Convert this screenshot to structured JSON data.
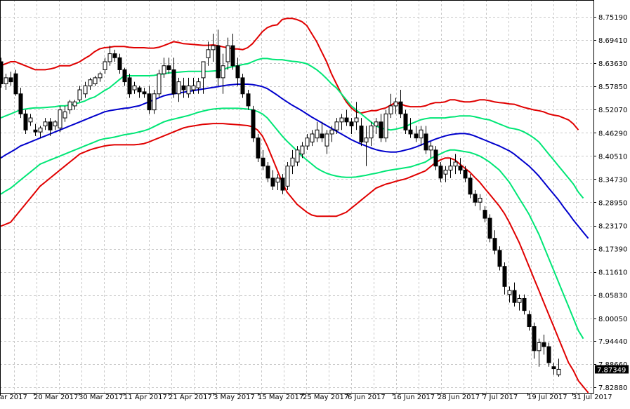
{
  "chart_data": {
    "type": "candlestick",
    "ylim": [
      7.8288,
      8.7519
    ],
    "y_ticks": [
      "8.75190",
      "8.69410",
      "8.63630",
      "8.57850",
      "8.52070",
      "8.46290",
      "8.40510",
      "8.34730",
      "8.28950",
      "8.23170",
      "8.17390",
      "8.11610",
      "8.05830",
      "8.00050",
      "7.94440",
      "7.88660",
      "7.82880"
    ],
    "x_tick_labels": [
      "ar 2017",
      "20 Mar 2017",
      "30 Mar 2017",
      "11 Apr 2017",
      "21 Apr 2017",
      "3 May 2017",
      "15 May 2017",
      "25 May 2017",
      "6 Jun 2017",
      "16 Jun 2017",
      "28 Jun 2017",
      "7 Jul 2017",
      "19 Jul 2017",
      "31 Jul 2017"
    ],
    "current_price": "7.87349",
    "grid": true,
    "colors": {
      "outer_band": "#e00000",
      "inner_band": "#00e676",
      "middle_ma": "#0000cc",
      "bull_candle": "#ffffff",
      "bear_candle": "#000000",
      "price_tag_bg": "#000000",
      "price_tag_text": "#ffffff"
    },
    "candles": [
      [
        8.64,
        8.65,
        8.575,
        8.585
      ],
      [
        8.585,
        8.61,
        8.57,
        8.6
      ],
      [
        8.6,
        8.615,
        8.58,
        8.59
      ],
      [
        8.61,
        8.62,
        8.555,
        8.56
      ],
      [
        8.56,
        8.575,
        8.5,
        8.51
      ],
      [
        8.51,
        8.52,
        8.46,
        8.47
      ],
      [
        8.49,
        8.51,
        8.48,
        8.5
      ],
      [
        8.47,
        8.485,
        8.455,
        8.465
      ],
      [
        8.465,
        8.48,
        8.45,
        8.475
      ],
      [
        8.48,
        8.5,
        8.47,
        8.49
      ],
      [
        8.49,
        8.5,
        8.455,
        8.47
      ],
      [
        8.48,
        8.495,
        8.47,
        8.49
      ],
      [
        8.475,
        8.53,
        8.465,
        8.52
      ],
      [
        8.5,
        8.53,
        8.49,
        8.515
      ],
      [
        8.52,
        8.545,
        8.51,
        8.54
      ],
      [
        8.53,
        8.545,
        8.52,
        8.54
      ],
      [
        8.545,
        8.58,
        8.54,
        8.57
      ],
      [
        8.56,
        8.59,
        8.55,
        8.58
      ],
      [
        8.58,
        8.6,
        8.57,
        8.595
      ],
      [
        8.585,
        8.605,
        8.58,
        8.6
      ],
      [
        8.6,
        8.615,
        8.59,
        8.61
      ],
      [
        8.62,
        8.65,
        8.61,
        8.64
      ],
      [
        8.64,
        8.68,
        8.63,
        8.66
      ],
      [
        8.66,
        8.67,
        8.64,
        8.65
      ],
      [
        8.65,
        8.66,
        8.61,
        8.62
      ],
      [
        8.62,
        8.625,
        8.58,
        8.59
      ],
      [
        8.6,
        8.61,
        8.55,
        8.56
      ],
      [
        8.57,
        8.59,
        8.56,
        8.58
      ],
      [
        8.575,
        8.58,
        8.55,
        8.565
      ],
      [
        8.565,
        8.575,
        8.55,
        8.56
      ],
      [
        8.56,
        8.58,
        8.51,
        8.52
      ],
      [
        8.52,
        8.57,
        8.51,
        8.56
      ],
      [
        8.56,
        8.62,
        8.55,
        8.61
      ],
      [
        8.61,
        8.65,
        8.6,
        8.63
      ],
      [
        8.63,
        8.65,
        8.61,
        8.62
      ],
      [
        8.62,
        8.65,
        8.55,
        8.56
      ],
      [
        8.56,
        8.6,
        8.54,
        8.59
      ],
      [
        8.58,
        8.6,
        8.55,
        8.57
      ],
      [
        8.56,
        8.6,
        8.55,
        8.58
      ],
      [
        8.57,
        8.6,
        8.56,
        8.58
      ],
      [
        8.575,
        8.6,
        8.56,
        8.59
      ],
      [
        8.6,
        8.64,
        8.56,
        8.64
      ],
      [
        8.65,
        8.69,
        8.63,
        8.67
      ],
      [
        8.67,
        8.71,
        8.64,
        8.68
      ],
      [
        8.68,
        8.72,
        8.58,
        8.6
      ],
      [
        8.6,
        8.66,
        8.56,
        8.63
      ],
      [
        8.64,
        8.7,
        8.62,
        8.68
      ],
      [
        8.68,
        8.71,
        8.62,
        8.63
      ],
      [
        8.63,
        8.65,
        8.58,
        8.6
      ],
      [
        8.6,
        8.61,
        8.55,
        8.56
      ],
      [
        8.56,
        8.57,
        8.52,
        8.53
      ],
      [
        8.52,
        8.53,
        8.44,
        8.45
      ],
      [
        8.45,
        8.46,
        8.39,
        8.4
      ],
      [
        8.4,
        8.42,
        8.37,
        8.38
      ],
      [
        8.38,
        8.39,
        8.34,
        8.35
      ],
      [
        8.35,
        8.37,
        8.32,
        8.33
      ],
      [
        8.34,
        8.36,
        8.32,
        8.35
      ],
      [
        8.35,
        8.36,
        8.31,
        8.32
      ],
      [
        8.33,
        8.39,
        8.32,
        8.38
      ],
      [
        8.38,
        8.42,
        8.36,
        8.4
      ],
      [
        8.39,
        8.43,
        8.38,
        8.42
      ],
      [
        8.41,
        8.44,
        8.4,
        8.43
      ],
      [
        8.43,
        8.46,
        8.42,
        8.45
      ],
      [
        8.44,
        8.47,
        8.43,
        8.46
      ],
      [
        8.45,
        8.49,
        8.44,
        8.47
      ],
      [
        8.46,
        8.49,
        8.44,
        8.45
      ],
      [
        8.43,
        8.47,
        8.41,
        8.46
      ],
      [
        8.46,
        8.48,
        8.44,
        8.47
      ],
      [
        8.47,
        8.5,
        8.46,
        8.49
      ],
      [
        8.49,
        8.51,
        8.47,
        8.5
      ],
      [
        8.5,
        8.52,
        8.48,
        8.49
      ],
      [
        8.49,
        8.5,
        8.46,
        8.48
      ],
      [
        8.49,
        8.54,
        8.47,
        8.5
      ],
      [
        8.48,
        8.5,
        8.43,
        8.44
      ],
      [
        8.44,
        8.48,
        8.38,
        8.45
      ],
      [
        8.45,
        8.49,
        8.43,
        8.48
      ],
      [
        8.48,
        8.5,
        8.46,
        8.49
      ],
      [
        8.49,
        8.51,
        8.44,
        8.45
      ],
      [
        8.45,
        8.52,
        8.44,
        8.51
      ],
      [
        8.51,
        8.56,
        8.5,
        8.53
      ],
      [
        8.53,
        8.55,
        8.51,
        8.54
      ],
      [
        8.54,
        8.57,
        8.5,
        8.51
      ],
      [
        8.51,
        8.52,
        8.46,
        8.47
      ],
      [
        8.47,
        8.5,
        8.45,
        8.46
      ],
      [
        8.46,
        8.48,
        8.44,
        8.45
      ],
      [
        8.45,
        8.48,
        8.43,
        8.47
      ],
      [
        8.46,
        8.48,
        8.41,
        8.42
      ],
      [
        8.42,
        8.44,
        8.4,
        8.43
      ],
      [
        8.42,
        8.43,
        8.37,
        8.38
      ],
      [
        8.38,
        8.39,
        8.34,
        8.35
      ],
      [
        8.36,
        8.38,
        8.34,
        8.37
      ],
      [
        8.37,
        8.4,
        8.35,
        8.38
      ],
      [
        8.38,
        8.41,
        8.36,
        8.39
      ],
      [
        8.38,
        8.4,
        8.36,
        8.37
      ],
      [
        8.37,
        8.38,
        8.34,
        8.35
      ],
      [
        8.35,
        8.36,
        8.3,
        8.31
      ],
      [
        8.31,
        8.32,
        8.28,
        8.29
      ],
      [
        8.29,
        8.31,
        8.27,
        8.3
      ],
      [
        8.27,
        8.28,
        8.24,
        8.25
      ],
      [
        8.25,
        8.26,
        8.19,
        8.2
      ],
      [
        8.2,
        8.22,
        8.16,
        8.17
      ],
      [
        8.17,
        8.18,
        8.12,
        8.13
      ],
      [
        8.13,
        8.14,
        8.06,
        8.08
      ],
      [
        8.06,
        8.08,
        8.04,
        8.07
      ],
      [
        8.07,
        8.09,
        8.03,
        8.04
      ],
      [
        8.04,
        8.06,
        8.02,
        8.05
      ],
      [
        8.05,
        8.06,
        8.01,
        8.02
      ],
      [
        8.01,
        8.02,
        7.97,
        7.98
      ],
      [
        7.98,
        7.99,
        7.9,
        7.92
      ],
      [
        7.92,
        7.95,
        7.88,
        7.94
      ],
      [
        7.94,
        7.96,
        7.91,
        7.93
      ],
      [
        7.93,
        7.94,
        7.88,
        7.89
      ],
      [
        7.88,
        7.89,
        7.86,
        7.875
      ],
      [
        7.86,
        7.9,
        7.855,
        7.87349
      ]
    ],
    "upper_outer_band": [
      8.63,
      8.635,
      8.64,
      8.64,
      8.635,
      8.63,
      8.625,
      8.62,
      8.62,
      8.62,
      8.622,
      8.625,
      8.63,
      8.63,
      8.63,
      8.635,
      8.64,
      8.648,
      8.655,
      8.665,
      8.672,
      8.675,
      8.676,
      8.678,
      8.678,
      8.678,
      8.676,
      8.675,
      8.675,
      8.675,
      8.674,
      8.674,
      8.676,
      8.68,
      8.685,
      8.69,
      8.688,
      8.685,
      8.684,
      8.683,
      8.682,
      8.681,
      8.681,
      8.682,
      8.68,
      8.677,
      8.675,
      8.672,
      8.672,
      8.67,
      8.675,
      8.685,
      8.7,
      8.715,
      8.725,
      8.73,
      8.732,
      8.745,
      8.748,
      8.748,
      8.745,
      8.74,
      8.73,
      8.71,
      8.69,
      8.665,
      8.64,
      8.61,
      8.585,
      8.56,
      8.54,
      8.525,
      8.515,
      8.512,
      8.515,
      8.518,
      8.518,
      8.522,
      8.525,
      8.532,
      8.538,
      8.535,
      8.53,
      8.528,
      8.528,
      8.528,
      8.53,
      8.535,
      8.538,
      8.538,
      8.54,
      8.545,
      8.545,
      8.542,
      8.54,
      8.54,
      8.542,
      8.545,
      8.545,
      8.543,
      8.54,
      8.538,
      8.537,
      8.535,
      8.534,
      8.53,
      8.526,
      8.523,
      8.52,
      8.518,
      8.515,
      8.51,
      8.507,
      8.505,
      8.5,
      8.495,
      8.485,
      8.47
    ],
    "upper_inner_band": [
      8.5,
      8.505,
      8.51,
      8.515,
      8.52,
      8.522,
      8.524,
      8.525,
      8.525,
      8.526,
      8.527,
      8.528,
      8.53,
      8.53,
      8.532,
      8.535,
      8.538,
      8.542,
      8.548,
      8.552,
      8.56,
      8.568,
      8.575,
      8.585,
      8.595,
      8.605,
      8.605,
      8.605,
      8.605,
      8.605,
      8.605,
      8.606,
      8.608,
      8.61,
      8.612,
      8.613,
      8.614,
      8.615,
      8.616,
      8.616,
      8.616,
      8.616,
      8.616,
      8.617,
      8.618,
      8.62,
      8.625,
      8.628,
      8.63,
      8.633,
      8.635,
      8.64,
      8.645,
      8.648,
      8.648,
      8.646,
      8.645,
      8.645,
      8.643,
      8.641,
      8.64,
      8.638,
      8.635,
      8.628,
      8.62,
      8.61,
      8.598,
      8.585,
      8.575,
      8.56,
      8.545,
      8.53,
      8.52,
      8.51,
      8.5,
      8.49,
      8.48,
      8.475,
      8.472,
      8.47,
      8.472,
      8.475,
      8.478,
      8.485,
      8.49,
      8.495,
      8.498,
      8.5,
      8.5,
      8.5,
      8.5,
      8.502,
      8.503,
      8.505,
      8.505,
      8.505,
      8.503,
      8.5,
      8.497,
      8.495,
      8.49,
      8.485,
      8.48,
      8.475,
      8.473,
      8.47,
      8.465,
      8.458,
      8.45,
      8.44,
      8.425,
      8.41,
      8.395,
      8.38,
      8.365,
      8.35,
      8.335,
      8.315,
      8.3
    ],
    "middle_ma": [
      8.4,
      8.408,
      8.415,
      8.422,
      8.43,
      8.435,
      8.44,
      8.445,
      8.45,
      8.455,
      8.46,
      8.465,
      8.47,
      8.475,
      8.48,
      8.485,
      8.49,
      8.495,
      8.5,
      8.505,
      8.51,
      8.515,
      8.518,
      8.52,
      8.522,
      8.524,
      8.525,
      8.528,
      8.53,
      8.535,
      8.54,
      8.545,
      8.55,
      8.555,
      8.558,
      8.56,
      8.562,
      8.564,
      8.566,
      8.568,
      8.57,
      8.572,
      8.574,
      8.576,
      8.578,
      8.58,
      8.582,
      8.583,
      8.584,
      8.584,
      8.584,
      8.583,
      8.581,
      8.578,
      8.573,
      8.565,
      8.557,
      8.548,
      8.54,
      8.532,
      8.525,
      8.518,
      8.51,
      8.502,
      8.495,
      8.488,
      8.481,
      8.474,
      8.467,
      8.46,
      8.453,
      8.446,
      8.44,
      8.435,
      8.43,
      8.425,
      8.421,
      8.418,
      8.416,
      8.415,
      8.415,
      8.417,
      8.42,
      8.423,
      8.427,
      8.432,
      8.437,
      8.442,
      8.447,
      8.451,
      8.455,
      8.458,
      8.46,
      8.461,
      8.461,
      8.459,
      8.455,
      8.45,
      8.445,
      8.44,
      8.435,
      8.43,
      8.424,
      8.418,
      8.41,
      8.4,
      8.39,
      8.38,
      8.368,
      8.355,
      8.34,
      8.325,
      8.31,
      8.295,
      8.278,
      8.262,
      8.245,
      8.23,
      8.215,
      8.2
    ],
    "lower_inner_band": [
      8.31,
      8.318,
      8.325,
      8.335,
      8.345,
      8.355,
      8.365,
      8.375,
      8.385,
      8.39,
      8.395,
      8.4,
      8.405,
      8.41,
      8.415,
      8.42,
      8.425,
      8.43,
      8.435,
      8.44,
      8.445,
      8.448,
      8.45,
      8.452,
      8.455,
      8.458,
      8.46,
      8.462,
      8.465,
      8.468,
      8.472,
      8.478,
      8.484,
      8.49,
      8.494,
      8.497,
      8.5,
      8.503,
      8.506,
      8.51,
      8.514,
      8.517,
      8.52,
      8.522,
      8.523,
      8.524,
      8.524,
      8.524,
      8.524,
      8.523,
      8.522,
      8.52,
      8.516,
      8.51,
      8.5,
      8.485,
      8.47,
      8.455,
      8.442,
      8.43,
      8.418,
      8.405,
      8.395,
      8.385,
      8.375,
      8.368,
      8.362,
      8.358,
      8.355,
      8.353,
      8.352,
      8.352,
      8.353,
      8.355,
      8.357,
      8.36,
      8.362,
      8.365,
      8.368,
      8.37,
      8.372,
      8.374,
      8.376,
      8.378,
      8.382,
      8.386,
      8.39,
      8.398,
      8.405,
      8.41,
      8.416,
      8.42,
      8.42,
      8.418,
      8.416,
      8.414,
      8.41,
      8.405,
      8.398,
      8.39,
      8.38,
      8.37,
      8.355,
      8.34,
      8.32,
      8.3,
      8.28,
      8.26,
      8.235,
      8.21,
      8.18,
      8.15,
      8.12,
      8.09,
      8.06,
      8.03,
      8.0,
      7.97,
      7.95
    ],
    "lower_outer_band": [
      8.23,
      8.235,
      8.24,
      8.255,
      8.27,
      8.285,
      8.3,
      8.315,
      8.33,
      8.34,
      8.35,
      8.36,
      8.37,
      8.38,
      8.39,
      8.4,
      8.41,
      8.415,
      8.42,
      8.424,
      8.427,
      8.43,
      8.432,
      8.433,
      8.433,
      8.433,
      8.433,
      8.433,
      8.434,
      8.436,
      8.44,
      8.445,
      8.45,
      8.455,
      8.46,
      8.465,
      8.47,
      8.475,
      8.478,
      8.48,
      8.482,
      8.484,
      8.485,
      8.486,
      8.486,
      8.486,
      8.485,
      8.484,
      8.483,
      8.482,
      8.481,
      8.478,
      8.47,
      8.455,
      8.43,
      8.4,
      8.37,
      8.34,
      8.315,
      8.3,
      8.285,
      8.275,
      8.265,
      8.258,
      8.255,
      8.255,
      8.255,
      8.255,
      8.255,
      8.26,
      8.265,
      8.275,
      8.285,
      8.295,
      8.305,
      8.315,
      8.325,
      8.33,
      8.335,
      8.338,
      8.342,
      8.345,
      8.348,
      8.353,
      8.358,
      8.363,
      8.368,
      8.378,
      8.388,
      8.395,
      8.4,
      8.4,
      8.395,
      8.385,
      8.375,
      8.365,
      8.352,
      8.34,
      8.325,
      8.31,
      8.295,
      8.28,
      8.262,
      8.24,
      8.215,
      8.19,
      8.16,
      8.13,
      8.1,
      8.07,
      8.04,
      8.01,
      7.98,
      7.95,
      7.92,
      7.89,
      7.87,
      7.845,
      7.83,
      7.815
    ]
  }
}
